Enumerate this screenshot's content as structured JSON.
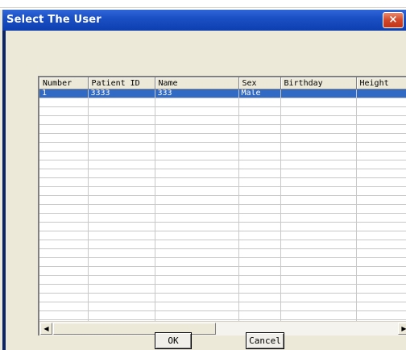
{
  "window": {
    "title": "Select The User",
    "close_glyph": "×"
  },
  "grid": {
    "columns": [
      "Number",
      "Patient ID",
      "Name",
      "Sex",
      "Birthday",
      "Height"
    ],
    "rows": [
      [
        "1",
        "3333",
        "333",
        "Male",
        "",
        ""
      ]
    ]
  },
  "scrollbar": {
    "left_glyph": "◀",
    "right_glyph": "▶"
  },
  "buttons": {
    "ok": "OK",
    "cancel": "Cancel"
  },
  "colors": {
    "selection": "#316ac5",
    "titlebar": "#1a4fc4",
    "close": "#d2472a"
  }
}
